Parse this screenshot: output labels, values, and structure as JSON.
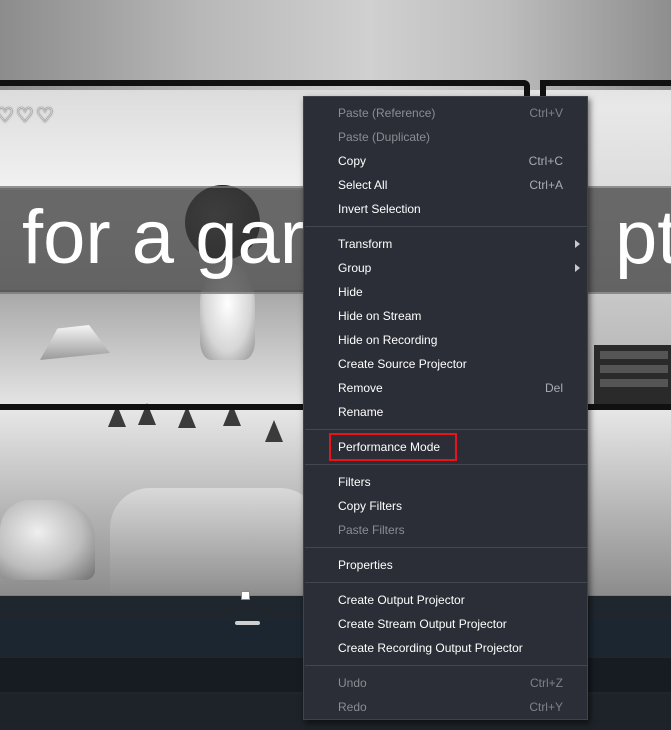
{
  "preview": {
    "caption_text": "for a gar",
    "caption_text_right": "ptu",
    "hearts": "♡♡♡"
  },
  "context_menu": {
    "groups": [
      [
        {
          "label": "Paste (Reference)",
          "shortcut": "Ctrl+V",
          "disabled": true
        },
        {
          "label": "Paste (Duplicate)",
          "shortcut": "",
          "disabled": true
        },
        {
          "label": "Copy",
          "shortcut": "Ctrl+C",
          "disabled": false
        },
        {
          "label": "Select All",
          "shortcut": "Ctrl+A",
          "disabled": false
        },
        {
          "label": "Invert Selection",
          "shortcut": "",
          "disabled": false
        }
      ],
      [
        {
          "label": "Transform",
          "shortcut": "",
          "disabled": false,
          "submenu": true
        },
        {
          "label": "Group",
          "shortcut": "",
          "disabled": false,
          "submenu": true
        },
        {
          "label": "Hide",
          "shortcut": "",
          "disabled": false
        },
        {
          "label": "Hide on Stream",
          "shortcut": "",
          "disabled": false
        },
        {
          "label": "Hide on Recording",
          "shortcut": "",
          "disabled": false
        },
        {
          "label": "Create Source Projector",
          "shortcut": "",
          "disabled": false
        },
        {
          "label": "Remove",
          "shortcut": "Del",
          "disabled": false
        },
        {
          "label": "Rename",
          "shortcut": "",
          "disabled": false
        }
      ],
      [
        {
          "label": "Performance Mode",
          "shortcut": "",
          "disabled": false,
          "highlighted": true
        }
      ],
      [
        {
          "label": "Filters",
          "shortcut": "",
          "disabled": false
        },
        {
          "label": "Copy Filters",
          "shortcut": "",
          "disabled": false
        },
        {
          "label": "Paste Filters",
          "shortcut": "",
          "disabled": true
        }
      ],
      [
        {
          "label": "Properties",
          "shortcut": "",
          "disabled": false
        }
      ],
      [
        {
          "label": "Create Output Projector",
          "shortcut": "",
          "disabled": false
        },
        {
          "label": "Create Stream Output Projector",
          "shortcut": "",
          "disabled": false
        },
        {
          "label": "Create Recording Output Projector",
          "shortcut": "",
          "disabled": false
        }
      ],
      [
        {
          "label": "Undo",
          "shortcut": "Ctrl+Z",
          "disabled": true
        },
        {
          "label": "Redo",
          "shortcut": "Ctrl+Y",
          "disabled": true
        }
      ]
    ]
  },
  "colors": {
    "menu_bg": "#2b2e36",
    "highlight_border": "#e8141a",
    "accent_line": "#3a9e8f"
  }
}
